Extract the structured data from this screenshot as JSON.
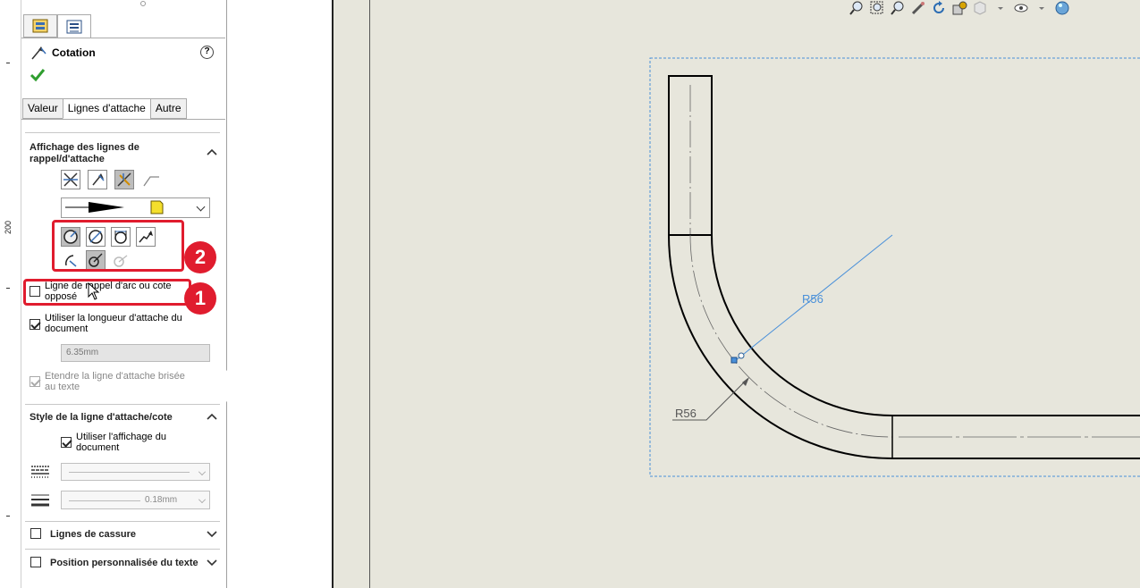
{
  "ruler": {
    "label": "200"
  },
  "panel": {
    "title": "Cotation",
    "help": "?",
    "tabs": [
      "Valeur",
      "Lignes d'attache",
      "Autre"
    ],
    "section1": {
      "title": "Affichage des lignes de rappel/d'attache",
      "opposite_arc_label": "Ligne de rappel d'arc ou cote opposé",
      "use_doc_length_label": "Utiliser la longueur d'attache du document",
      "length_value": "6.35mm",
      "extend_label": "Etendre la ligne d'attache brisée au texte"
    },
    "section2": {
      "title": "Style de la ligne d'attache/cote",
      "use_doc_display_label": "Utiliser l'affichage du document",
      "thickness_value": "0.18mm"
    },
    "section3": {
      "title": "Lignes de cassure"
    },
    "section4": {
      "title": "Position personnalisée du texte"
    },
    "badges": [
      "1",
      "2"
    ]
  },
  "drawing": {
    "dimension_selected": "R56",
    "dimension_other": "R56"
  },
  "colors": {
    "highlight": "#e01c2e",
    "selected_dim": "#4a90d9"
  }
}
